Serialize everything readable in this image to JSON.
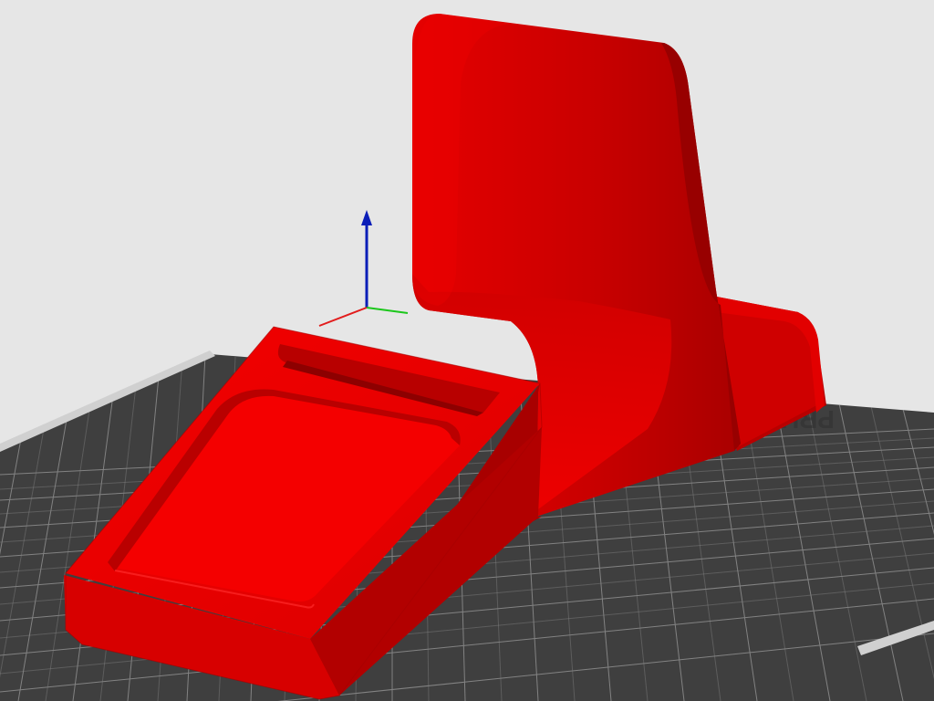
{
  "viewport": {
    "background_color": "#e6e6e6"
  },
  "print_bed": {
    "bed_color": "#3f3f3f",
    "grid_color": "#8a8a8a",
    "edge_color": "#d8d8d8",
    "bed_label_text": "PRUSA",
    "label_reversed": true
  },
  "axes": {
    "z_axis_color": "#0b1eb8",
    "x_axis_color": "#e21c1c",
    "y_axis_color": "#1cc71c"
  },
  "model": {
    "type": "phone-stand",
    "base_color": "#e30000",
    "shadow_color": "#b90000",
    "highlight_color": "#ff1a1a",
    "outline_color": "#a50000"
  }
}
